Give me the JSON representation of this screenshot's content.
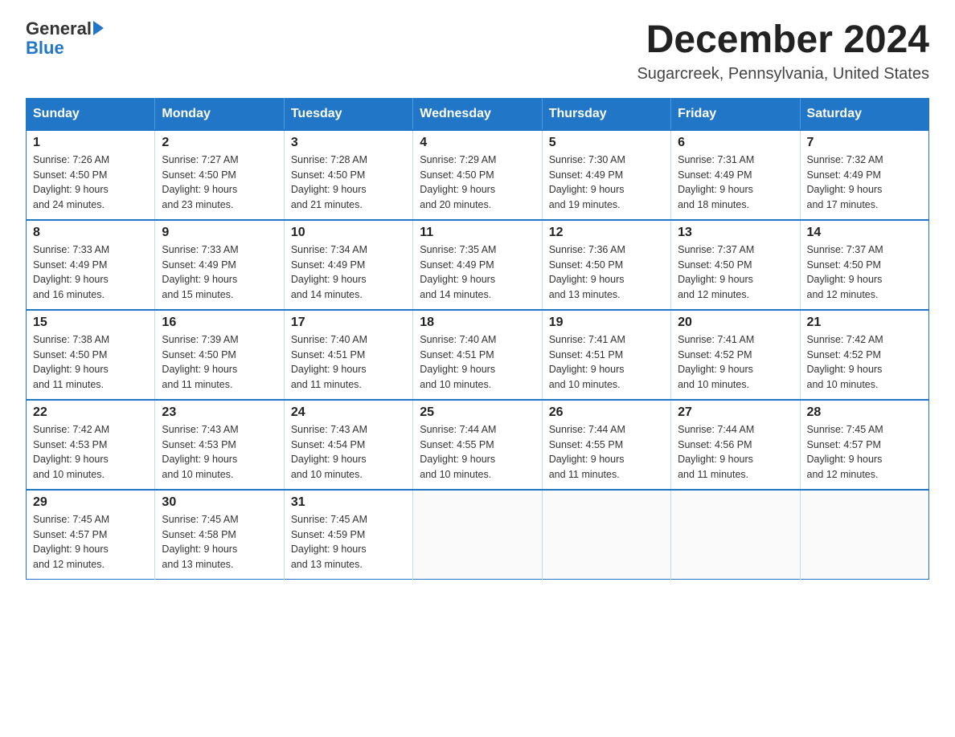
{
  "header": {
    "logo_general": "General",
    "logo_blue": "Blue",
    "title": "December 2024",
    "subtitle": "Sugarcreek, Pennsylvania, United States"
  },
  "weekdays": [
    "Sunday",
    "Monday",
    "Tuesday",
    "Wednesday",
    "Thursday",
    "Friday",
    "Saturday"
  ],
  "weeks": [
    [
      {
        "day": "1",
        "sunrise": "7:26 AM",
        "sunset": "4:50 PM",
        "daylight": "9 hours and 24 minutes."
      },
      {
        "day": "2",
        "sunrise": "7:27 AM",
        "sunset": "4:50 PM",
        "daylight": "9 hours and 23 minutes."
      },
      {
        "day": "3",
        "sunrise": "7:28 AM",
        "sunset": "4:50 PM",
        "daylight": "9 hours and 21 minutes."
      },
      {
        "day": "4",
        "sunrise": "7:29 AM",
        "sunset": "4:50 PM",
        "daylight": "9 hours and 20 minutes."
      },
      {
        "day": "5",
        "sunrise": "7:30 AM",
        "sunset": "4:49 PM",
        "daylight": "9 hours and 19 minutes."
      },
      {
        "day": "6",
        "sunrise": "7:31 AM",
        "sunset": "4:49 PM",
        "daylight": "9 hours and 18 minutes."
      },
      {
        "day": "7",
        "sunrise": "7:32 AM",
        "sunset": "4:49 PM",
        "daylight": "9 hours and 17 minutes."
      }
    ],
    [
      {
        "day": "8",
        "sunrise": "7:33 AM",
        "sunset": "4:49 PM",
        "daylight": "9 hours and 16 minutes."
      },
      {
        "day": "9",
        "sunrise": "7:33 AM",
        "sunset": "4:49 PM",
        "daylight": "9 hours and 15 minutes."
      },
      {
        "day": "10",
        "sunrise": "7:34 AM",
        "sunset": "4:49 PM",
        "daylight": "9 hours and 14 minutes."
      },
      {
        "day": "11",
        "sunrise": "7:35 AM",
        "sunset": "4:49 PM",
        "daylight": "9 hours and 14 minutes."
      },
      {
        "day": "12",
        "sunrise": "7:36 AM",
        "sunset": "4:50 PM",
        "daylight": "9 hours and 13 minutes."
      },
      {
        "day": "13",
        "sunrise": "7:37 AM",
        "sunset": "4:50 PM",
        "daylight": "9 hours and 12 minutes."
      },
      {
        "day": "14",
        "sunrise": "7:37 AM",
        "sunset": "4:50 PM",
        "daylight": "9 hours and 12 minutes."
      }
    ],
    [
      {
        "day": "15",
        "sunrise": "7:38 AM",
        "sunset": "4:50 PM",
        "daylight": "9 hours and 11 minutes."
      },
      {
        "day": "16",
        "sunrise": "7:39 AM",
        "sunset": "4:50 PM",
        "daylight": "9 hours and 11 minutes."
      },
      {
        "day": "17",
        "sunrise": "7:40 AM",
        "sunset": "4:51 PM",
        "daylight": "9 hours and 11 minutes."
      },
      {
        "day": "18",
        "sunrise": "7:40 AM",
        "sunset": "4:51 PM",
        "daylight": "9 hours and 10 minutes."
      },
      {
        "day": "19",
        "sunrise": "7:41 AM",
        "sunset": "4:51 PM",
        "daylight": "9 hours and 10 minutes."
      },
      {
        "day": "20",
        "sunrise": "7:41 AM",
        "sunset": "4:52 PM",
        "daylight": "9 hours and 10 minutes."
      },
      {
        "day": "21",
        "sunrise": "7:42 AM",
        "sunset": "4:52 PM",
        "daylight": "9 hours and 10 minutes."
      }
    ],
    [
      {
        "day": "22",
        "sunrise": "7:42 AM",
        "sunset": "4:53 PM",
        "daylight": "9 hours and 10 minutes."
      },
      {
        "day": "23",
        "sunrise": "7:43 AM",
        "sunset": "4:53 PM",
        "daylight": "9 hours and 10 minutes."
      },
      {
        "day": "24",
        "sunrise": "7:43 AM",
        "sunset": "4:54 PM",
        "daylight": "9 hours and 10 minutes."
      },
      {
        "day": "25",
        "sunrise": "7:44 AM",
        "sunset": "4:55 PM",
        "daylight": "9 hours and 10 minutes."
      },
      {
        "day": "26",
        "sunrise": "7:44 AM",
        "sunset": "4:55 PM",
        "daylight": "9 hours and 11 minutes."
      },
      {
        "day": "27",
        "sunrise": "7:44 AM",
        "sunset": "4:56 PM",
        "daylight": "9 hours and 11 minutes."
      },
      {
        "day": "28",
        "sunrise": "7:45 AM",
        "sunset": "4:57 PM",
        "daylight": "9 hours and 12 minutes."
      }
    ],
    [
      {
        "day": "29",
        "sunrise": "7:45 AM",
        "sunset": "4:57 PM",
        "daylight": "9 hours and 12 minutes."
      },
      {
        "day": "30",
        "sunrise": "7:45 AM",
        "sunset": "4:58 PM",
        "daylight": "9 hours and 13 minutes."
      },
      {
        "day": "31",
        "sunrise": "7:45 AM",
        "sunset": "4:59 PM",
        "daylight": "9 hours and 13 minutes."
      },
      null,
      null,
      null,
      null
    ]
  ],
  "labels": {
    "sunrise": "Sunrise:",
    "sunset": "Sunset:",
    "daylight": "Daylight:"
  }
}
